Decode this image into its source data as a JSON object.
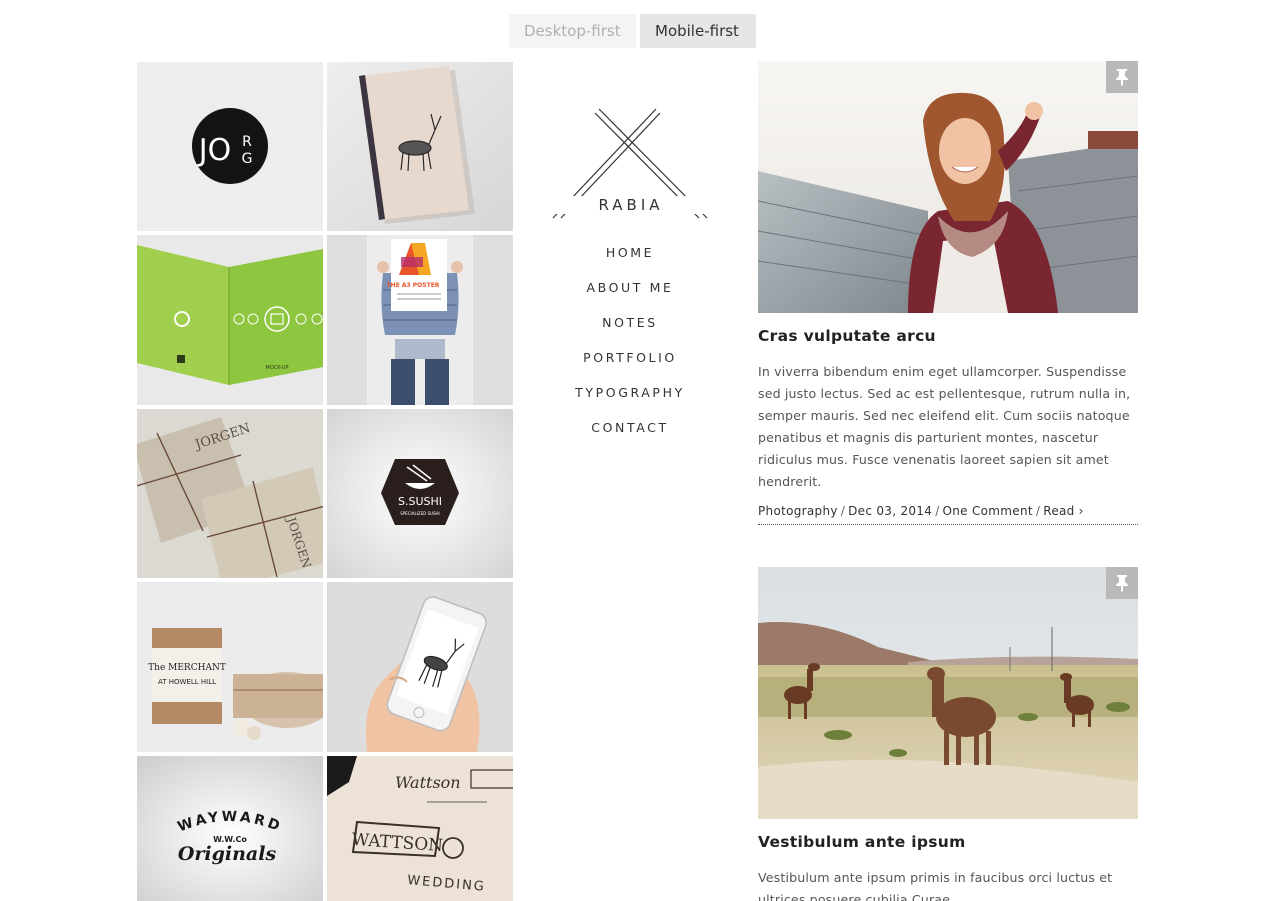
{
  "toggle": {
    "desktop_first": "Desktop-first",
    "mobile_first": "Mobile-first",
    "active": "Mobile-first"
  },
  "brand": {
    "name": "RABIA"
  },
  "nav": [
    "HOME",
    "ABOUT ME",
    "NOTES",
    "PORTFOLIO",
    "TYPOGRAPHY",
    "CONTACT"
  ],
  "portfolio": {
    "tiles": [
      {
        "name": "jorg-logo-tile",
        "text": "JORG"
      },
      {
        "name": "deer-notebook-tile",
        "text": ""
      },
      {
        "name": "green-brochure-tile",
        "text": "MOCK-UP"
      },
      {
        "name": "poster-tile",
        "text": "THE A3 POSTER"
      },
      {
        "name": "jorgen-packages-tile",
        "text": "JORGEN"
      },
      {
        "name": "sushi-logo-tile",
        "text": "S.SUSHI",
        "subtext": "SPECIALIZED SUSHI"
      },
      {
        "name": "merchant-box-tile",
        "text": "The MERCHANT",
        "subtext": "AT HOWELL HILL"
      },
      {
        "name": "phone-mockup-tile",
        "text": ""
      },
      {
        "name": "wayward-logo-tile",
        "text": "WAYWARD",
        "subtext": "W.W.Co",
        "script": "Originals"
      },
      {
        "name": "wattson-sketch-tile",
        "text": "WATTSON",
        "subtext": "WEDDING",
        "script": "Wattson"
      }
    ]
  },
  "posts": [
    {
      "title": "Cras vulputate arcu",
      "excerpt": "In viverra bibendum enim eget ullamcorper. Suspendisse sed justo lectus. Sed ac est pellentesque, rutrum nulla in, semper mauris. Sed nec eleifend elit. Cum sociis natoque penatibus et magnis dis parturient montes, nascetur ridiculus mus. Fusce venenatis laoreet sapien sit amet hendrerit.",
      "meta": {
        "category": "Photography",
        "date": "Dec 03, 2014",
        "comments": "One Comment",
        "read": "Read ›"
      }
    },
    {
      "title": "Vestibulum ante ipsum",
      "excerpt": "Vestibulum ante ipsum primis in faucibus orci luctus et ultrices posuere cubilia Curae"
    }
  ],
  "colors": {
    "accent": "#333333",
    "toggle_off_bg": "#f4f4f4",
    "toggle_on_bg": "#e6e6e6",
    "pin_bg": "#b9b9b9"
  },
  "icons": {
    "pin": "pin-icon"
  }
}
